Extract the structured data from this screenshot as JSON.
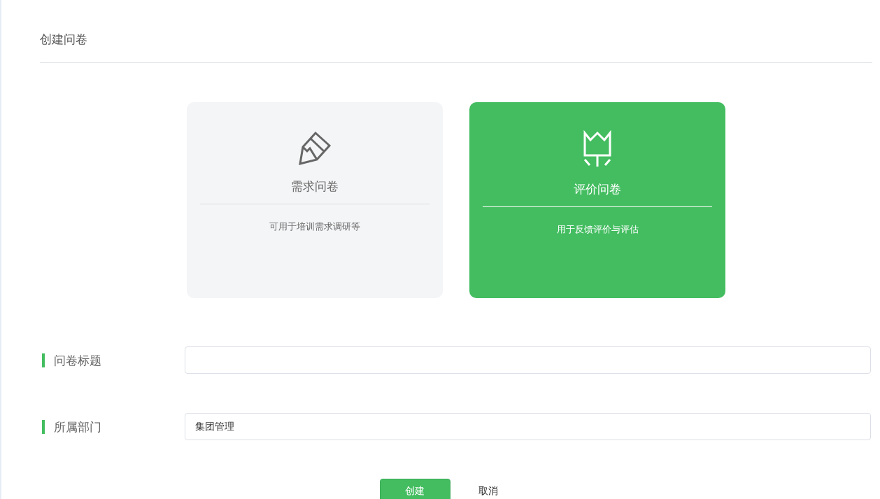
{
  "page_title": "创建问卷",
  "types": [
    {
      "title": "需求问卷",
      "description": "可用于培训需求调研等",
      "selected": false
    },
    {
      "title": "评价问卷",
      "description": "用于反馈评价与评估",
      "selected": true
    }
  ],
  "fields": [
    {
      "label": "问卷标题"
    },
    {
      "label": "所属部门",
      "value": "集团管理"
    }
  ],
  "buttons": {
    "submit": "创建",
    "cancel": "取消"
  }
}
